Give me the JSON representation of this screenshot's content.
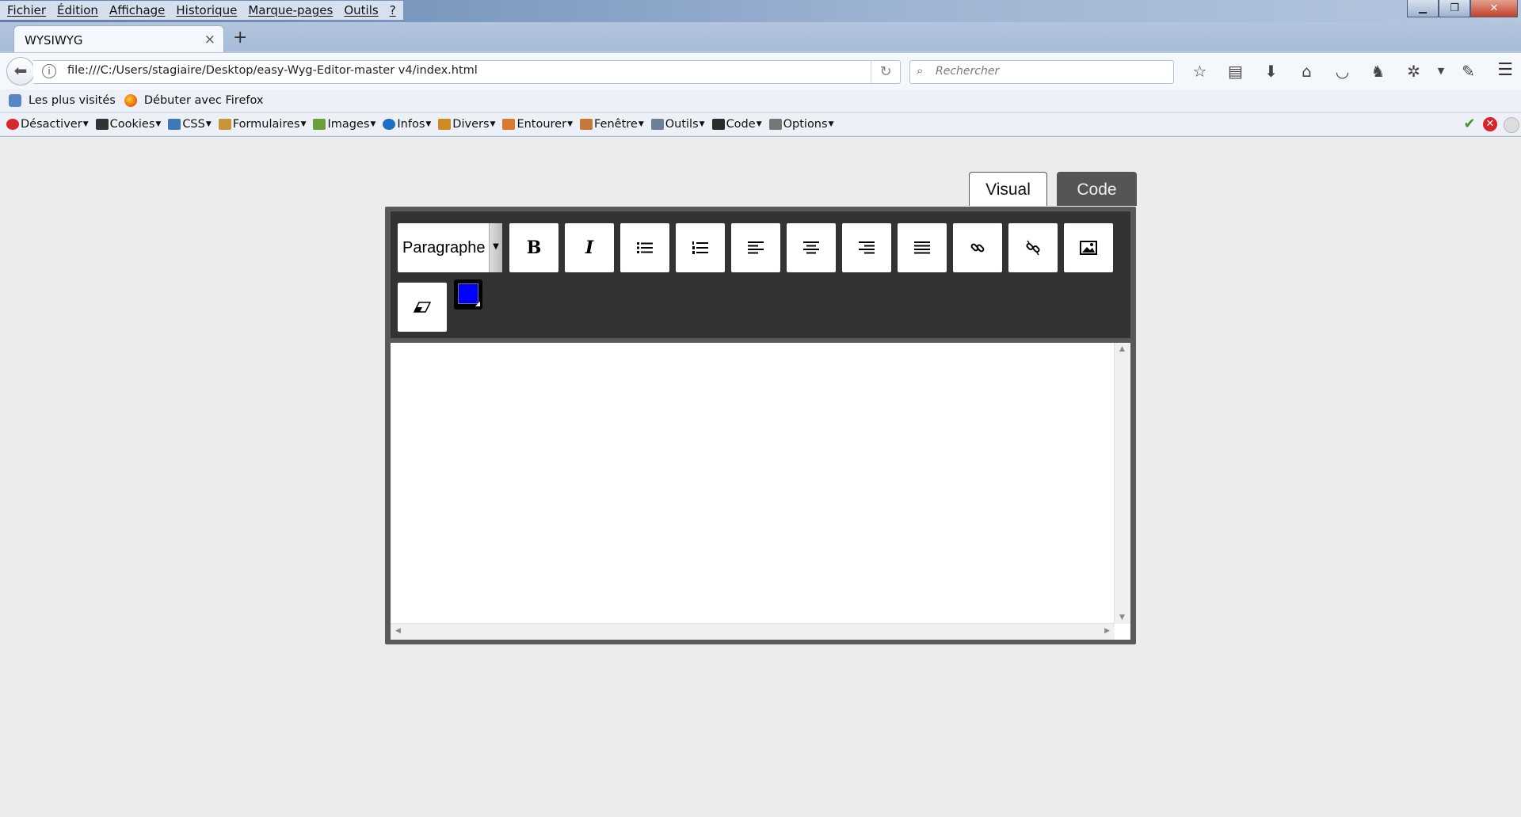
{
  "menubar": {
    "items": [
      "Fichier",
      "Édition",
      "Affichage",
      "Historique",
      "Marque-pages",
      "Outils",
      "?"
    ]
  },
  "tabs": [
    {
      "title": "WYSIWYG",
      "close": "×"
    }
  ],
  "new_tab": "+",
  "navbar": {
    "url": "file:///C:/Users/stagiaire/Desktop/easy-Wyg-Editor-master v4/index.html",
    "search_placeholder": "Rechercher",
    "icons": [
      "star-icon",
      "reading-list-icon",
      "download-icon",
      "home-icon",
      "pocket-icon",
      "extension-icon",
      "addon-icon",
      "dropdown-icon",
      "eyedropper-icon"
    ]
  },
  "bookmarks": [
    {
      "label": "Les plus visités",
      "icon": "most-visited-icon"
    },
    {
      "label": "Débuter avec Firefox",
      "icon": "firefox-icon"
    }
  ],
  "devtoolbar": {
    "items": [
      "Désactiver",
      "Cookies",
      "CSS",
      "Formulaires",
      "Images",
      "Infos",
      "Divers",
      "Entourer",
      "Fenêtre",
      "Outils",
      "Code",
      "Options"
    ],
    "icon_colors": [
      "#d9272e",
      "#333333",
      "#3f78b5",
      "#c6963a",
      "#6a9e3a",
      "#1f6fc8",
      "#d08a22",
      "#d87a30",
      "#c27a3a",
      "#6d7f99",
      "#2c2c2c",
      "#777777"
    ]
  },
  "editor": {
    "mode_tabs": [
      "Visual",
      "Code"
    ],
    "active_mode": "Code",
    "format_select": "Paragraphe",
    "toolbar_buttons": [
      {
        "name": "bold-button",
        "glyph": "B"
      },
      {
        "name": "italic-button",
        "glyph": "I"
      },
      {
        "name": "bullet-list-button",
        "icon": "bullet-list-icon"
      },
      {
        "name": "numbered-list-button",
        "icon": "numbered-list-icon"
      },
      {
        "name": "align-left-button",
        "icon": "align-left-icon"
      },
      {
        "name": "align-center-button",
        "icon": "align-center-icon"
      },
      {
        "name": "align-right-button",
        "icon": "align-right-icon"
      },
      {
        "name": "justify-button",
        "icon": "justify-icon"
      },
      {
        "name": "link-button",
        "icon": "link-icon"
      },
      {
        "name": "unlink-button",
        "icon": "unlink-icon"
      },
      {
        "name": "image-button",
        "icon": "image-icon"
      },
      {
        "name": "eraser-button",
        "icon": "eraser-icon"
      }
    ],
    "text_color": "#0000ff",
    "content": ""
  }
}
